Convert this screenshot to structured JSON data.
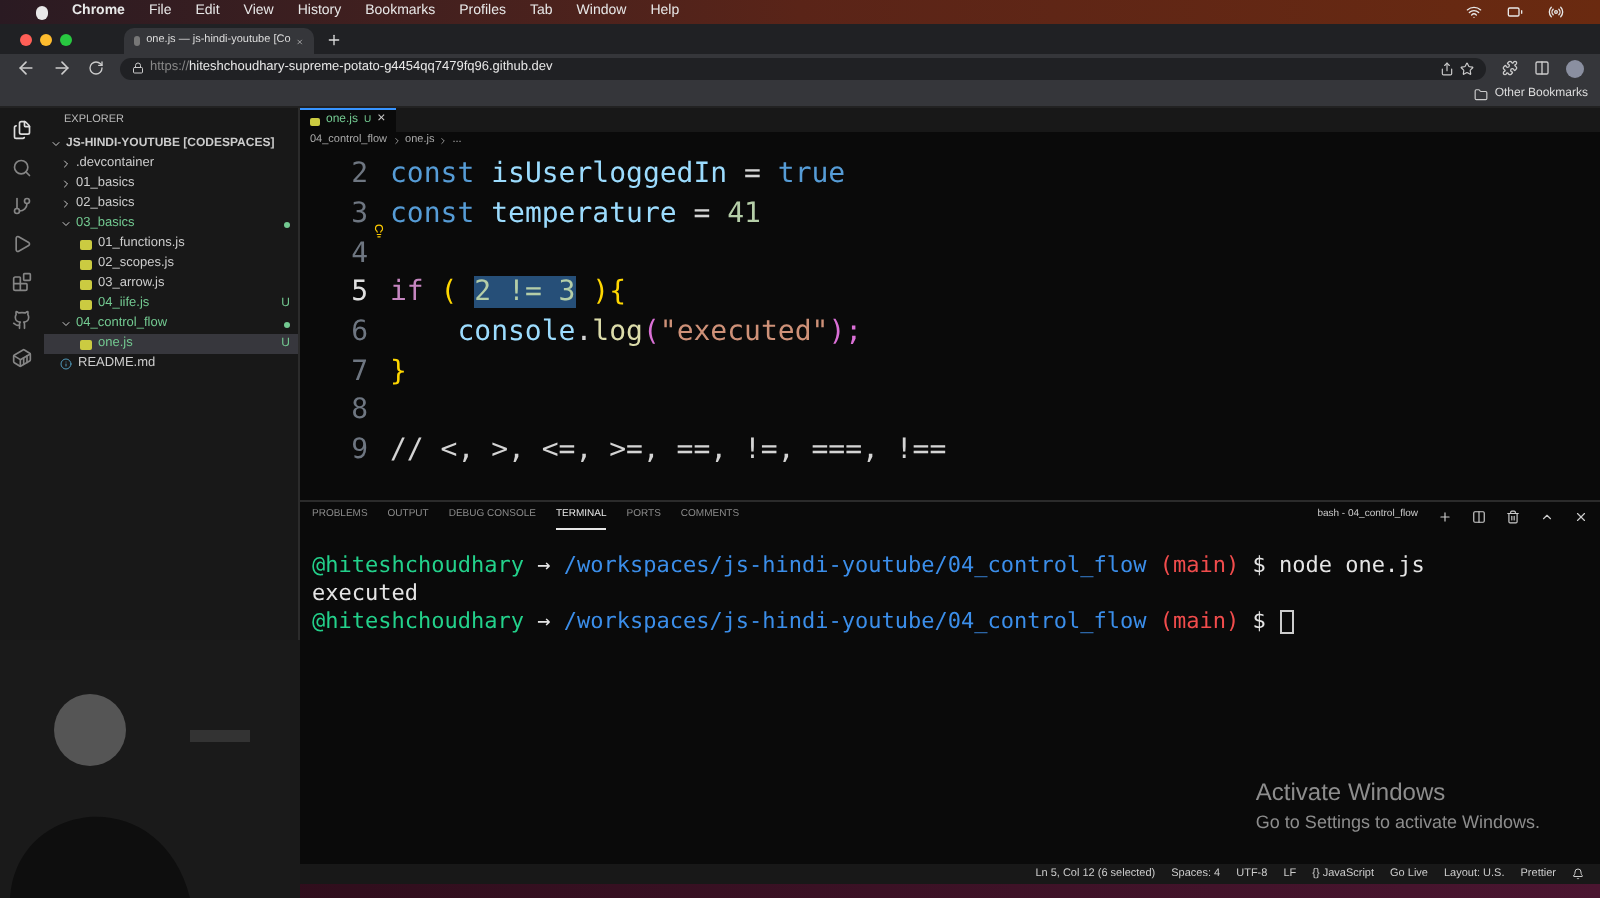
{
  "menu_bar": {
    "app": "Chrome",
    "items": [
      "File",
      "Edit",
      "View",
      "History",
      "Bookmarks",
      "Profiles",
      "Tab",
      "Window",
      "Help"
    ]
  },
  "browser": {
    "tab_title": "one.js — js-hindi-youtube [Co",
    "url_scheme": "https://",
    "url_host": "hiteshchoudhary-supreme-potato-g4454qq7479fq96.github.dev",
    "bookmarks": [
      "Other Bookmarks"
    ]
  },
  "explorer": {
    "title": "EXPLORER",
    "root": "JS-HINDI-YOUTUBE [CODESPACES]",
    "items": [
      {
        "name": ".devcontainer",
        "kind": "folder",
        "expanded": false,
        "untracked": false,
        "selected": false
      },
      {
        "name": "01_basics",
        "kind": "folder",
        "expanded": false,
        "untracked": false,
        "selected": false
      },
      {
        "name": "02_basics",
        "kind": "folder",
        "expanded": false,
        "untracked": false,
        "selected": false
      },
      {
        "name": "03_basics",
        "kind": "folder",
        "expanded": true,
        "untracked": true,
        "selected": false,
        "children": [
          {
            "name": "01_functions.js",
            "kind": "js",
            "untracked": false,
            "selected": false
          },
          {
            "name": "02_scopes.js",
            "kind": "js",
            "untracked": false,
            "selected": false
          },
          {
            "name": "03_arrow.js",
            "kind": "js",
            "untracked": false,
            "selected": false
          },
          {
            "name": "04_iife.js",
            "kind": "js",
            "untracked": true,
            "badge": "U",
            "selected": false
          }
        ]
      },
      {
        "name": "04_control_flow",
        "kind": "folder",
        "expanded": true,
        "untracked": true,
        "selected": false,
        "children": [
          {
            "name": "one.js",
            "kind": "js",
            "untracked": true,
            "badge": "U",
            "selected": true
          }
        ]
      },
      {
        "name": "README.md",
        "kind": "info",
        "untracked": false,
        "selected": false
      }
    ]
  },
  "editor": {
    "tab": {
      "name": "one.js",
      "badge": "U",
      "close": "×"
    },
    "breadcrumb": [
      "04_control_flow",
      "one.js",
      "..."
    ],
    "lines": [
      {
        "number": "2",
        "current": false,
        "lightbulb": false,
        "tokens": [
          {
            "text": "const",
            "kind": "keyword"
          },
          {
            "text": " isUserloggedIn",
            "kind": "variable"
          },
          {
            "text": " = ",
            "kind": "plain"
          },
          {
            "text": "true",
            "kind": "keyword"
          }
        ]
      },
      {
        "number": "3",
        "current": false,
        "lightbulb": false,
        "tokens": [
          {
            "text": "const",
            "kind": "keyword"
          },
          {
            "text": " temperature",
            "kind": "variable"
          },
          {
            "text": " = ",
            "kind": "plain"
          },
          {
            "text": "41",
            "kind": "number"
          }
        ]
      },
      {
        "number": "4",
        "current": false,
        "lightbulb": true
      },
      {
        "number": "5",
        "current": true,
        "lightbulb": false,
        "tokens": [
          {
            "text": "if",
            "kind": "control"
          },
          {
            "text": " ( ",
            "kind": "paren"
          },
          {
            "text": "2 != 3",
            "kind": "selection"
          },
          {
            "text": " ){",
            "kind": "paren"
          }
        ]
      },
      {
        "number": "6",
        "current": false,
        "lightbulb": false,
        "tokens": [
          {
            "text": "    console",
            "kind": "variable"
          },
          {
            "text": ".",
            "kind": "plain"
          },
          {
            "text": "log",
            "kind": "function"
          },
          {
            "text": "(",
            "kind": "paren2"
          },
          {
            "text": "\"executed\"",
            "kind": "string"
          },
          {
            "text": ");",
            "kind": "paren2"
          }
        ]
      },
      {
        "number": "7",
        "current": false,
        "lightbulb": false,
        "tokens": [
          {
            "text": "}",
            "kind": "paren"
          }
        ]
      },
      {
        "number": "8",
        "current": false,
        "lightbulb": false
      },
      {
        "number": "9",
        "current": false,
        "lightbulb": false,
        "tokens": [
          {
            "text": "// <, >, <=, >=, ==, !=, ===, !==",
            "kind": "comment"
          }
        ]
      }
    ]
  },
  "panel": {
    "tabs": [
      {
        "label": "PROBLEMS",
        "selected": false
      },
      {
        "label": "OUTPUT",
        "selected": false
      },
      {
        "label": "DEBUG CONSOLE",
        "selected": false
      },
      {
        "label": "TERMINAL",
        "selected": true
      },
      {
        "label": "PORTS",
        "selected": false
      },
      {
        "label": "COMMENTS",
        "selected": false
      }
    ],
    "terminal_name": "bash - 04_control_flow",
    "lines": [
      {
        "cursor": false,
        "segments": [
          {
            "text": "@hiteshchoudhary",
            "kind": "user"
          },
          {
            "text": " → ",
            "kind": "plain"
          },
          {
            "text": "/workspaces/js-hindi-youtube/04_control_flow",
            "kind": "path"
          },
          {
            "text": " (main)",
            "kind": "branch"
          },
          {
            "text": " $ node one.js",
            "kind": "plain"
          }
        ]
      },
      {
        "cursor": false,
        "segments": [
          {
            "text": "executed",
            "kind": "plain"
          }
        ]
      },
      {
        "cursor": true,
        "segments": [
          {
            "text": "@hiteshchoudhary",
            "kind": "user"
          },
          {
            "text": " → ",
            "kind": "plain"
          },
          {
            "text": "/workspaces/js-hindi-youtube/04_control_flow",
            "kind": "path"
          },
          {
            "text": " (main)",
            "kind": "branch"
          },
          {
            "text": " $",
            "kind": "plain"
          }
        ]
      }
    ]
  },
  "activation": {
    "title": "Activate Windows",
    "message": "Go to Settings to activate Windows."
  },
  "status_bar": [
    "Ln 5, Col 12 (6 selected)",
    "Spaces: 4",
    "UTF-8",
    "LF",
    "{} JavaScript",
    "Go Live",
    "Layout: U.S.",
    "Prettier"
  ]
}
